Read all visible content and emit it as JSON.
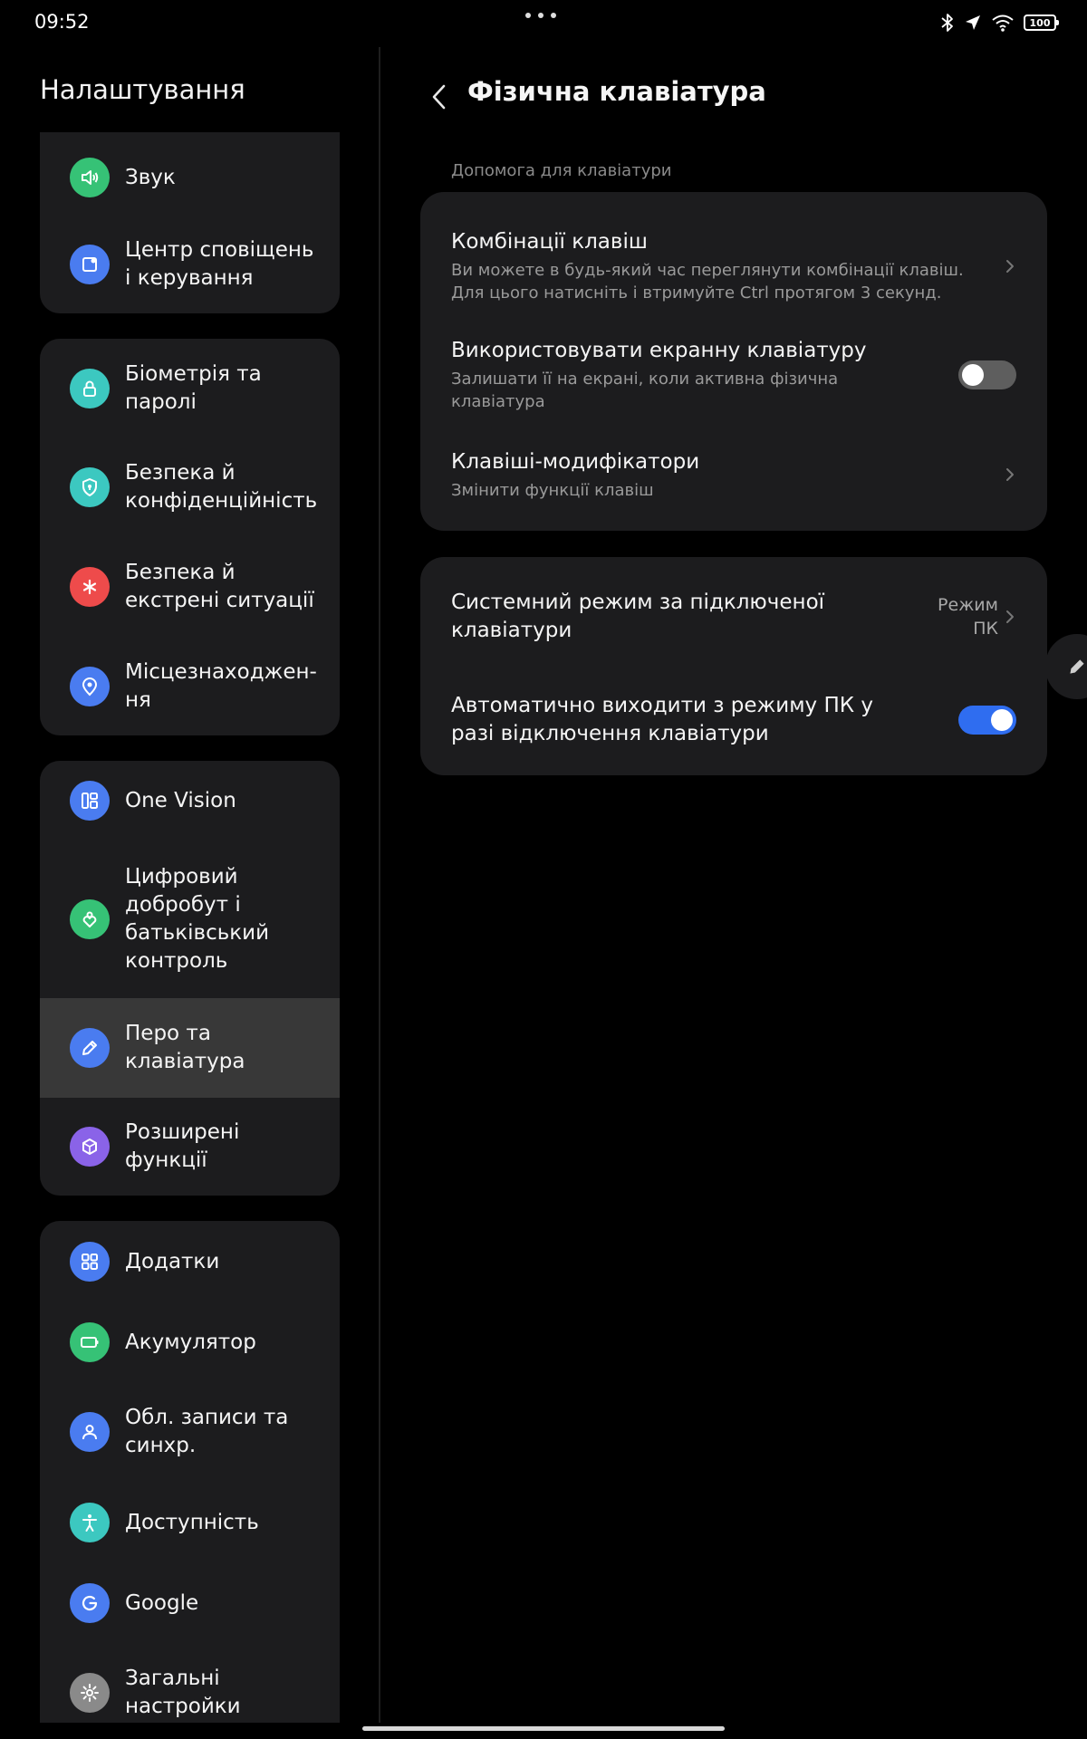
{
  "status": {
    "time": "09:52",
    "battery": "100"
  },
  "left": {
    "title": "Налаштування",
    "items": [
      {
        "label": "Звук",
        "icon": "speaker-icon",
        "color": "#36c276"
      },
      {
        "label": "Центр сповіщень і керування",
        "icon": "notification-panel-icon",
        "color": "#4a7cf0"
      },
      {
        "label": "Біометрія та паролі",
        "icon": "lock-icon",
        "color": "#3cc8c0"
      },
      {
        "label": "Безпека й конфіденційність",
        "icon": "shield-icon",
        "color": "#3cc8c0"
      },
      {
        "label": "Безпека й екстрені ситуації",
        "icon": "asterisk-icon",
        "color": "#ee4b4b"
      },
      {
        "label": "Місцезнаходжен-ня",
        "icon": "location-pin-icon",
        "color": "#4a7cf0"
      },
      {
        "label": "One Vision",
        "icon": "layout-icon",
        "color": "#4a7cf0"
      },
      {
        "label": "Цифровий добробут і батьківський контроль",
        "icon": "wellbeing-icon",
        "color": "#36c276"
      },
      {
        "label": "Перо та клавіатура",
        "icon": "pen-icon",
        "color": "#4a7cf0"
      },
      {
        "label": "Розширені функції",
        "icon": "cube-icon",
        "color": "#8a63e8"
      },
      {
        "label": "Додатки",
        "icon": "apps-grid-icon",
        "color": "#4a7cf0"
      },
      {
        "label": "Акумулятор",
        "icon": "battery-icon",
        "color": "#36c276"
      },
      {
        "label": "Обл. записи та синхр.",
        "icon": "user-icon",
        "color": "#4a7cf0"
      },
      {
        "label": "Доступність",
        "icon": "accessibility-icon",
        "color": "#3cc8c0"
      },
      {
        "label": "Google",
        "icon": "google-icon",
        "color": "#4a7cf0"
      },
      {
        "label": "Загальні настройки",
        "icon": "gear-icon",
        "color": "#8a8a8a"
      }
    ]
  },
  "right": {
    "title": "Фізична клавіатура",
    "section_label": "Допомога для клавіатури",
    "shortcuts": {
      "title": "Комбінації клавіш",
      "subtitle": "Ви можете в будь-який час переглянути комбінації клавіш. Для цього натисніть і втримуйте Ctrl протягом 3 секунд."
    },
    "onscreen": {
      "title": "Використовувати екранну клавіатуру",
      "subtitle": "Залишати її на екрані, коли активна фізична клавіатура",
      "enabled": false
    },
    "modifiers": {
      "title": "Клавіші-модифікатори",
      "subtitle": "Змінити функції клавіш"
    },
    "system_mode": {
      "title": "Системний режим за підключеної клавіатури",
      "value": "Режим ПК"
    },
    "auto_exit": {
      "title": "Автоматично виходити з режиму ПК у разі відключення клавіатури",
      "enabled": true
    }
  },
  "colors": {
    "accent": "#2f6df0",
    "card": "#1c1c1e",
    "selected": "#383838"
  }
}
